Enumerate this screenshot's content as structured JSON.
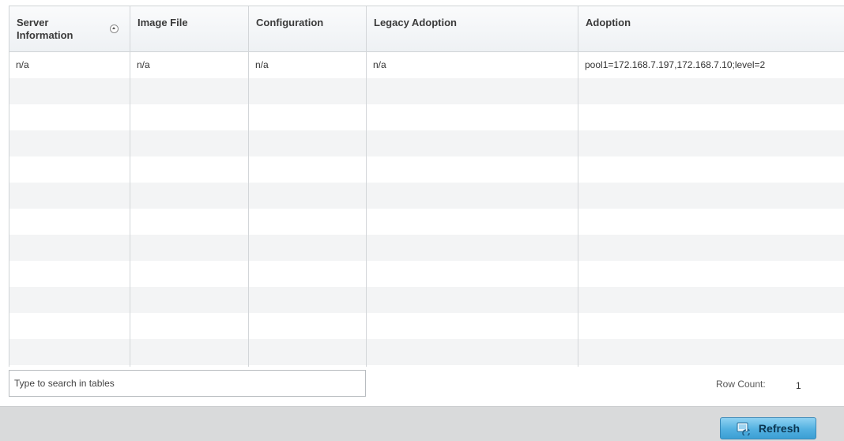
{
  "table": {
    "columns": [
      {
        "label_line1": "Server",
        "label_line2": "Information",
        "sortable": true
      },
      {
        "label": "Image File"
      },
      {
        "label": "Configuration"
      },
      {
        "label": "Legacy Adoption"
      },
      {
        "label": "Adoption"
      }
    ],
    "rows": [
      [
        "n/a",
        "n/a",
        "n/a",
        "n/a",
        "pool1=172.168.7.197,172.168.7.10;level=2"
      ]
    ]
  },
  "search": {
    "placeholder": "Type to search in tables"
  },
  "row_count": {
    "label": "Row Count:",
    "value": "1"
  },
  "footer": {
    "refresh_label": "Refresh",
    "refresh_icon": "refresh-icon"
  },
  "colors": {
    "header_gradient_top": "#fafbfc",
    "alt_row": "#f3f4f5",
    "refresh_button": "#52b0e0",
    "footer_bar": "#d9dadb"
  }
}
